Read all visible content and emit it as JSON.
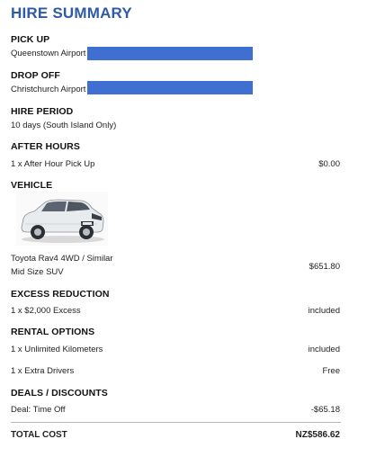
{
  "title": "HIRE SUMMARY",
  "pickup": {
    "heading": "PICK UP",
    "location": "Queenstown Airport"
  },
  "dropoff": {
    "heading": "DROP OFF",
    "location": "Christchurch Airport"
  },
  "hire_period": {
    "heading": "HIRE PERIOD",
    "value": "10 days (South Island Only)"
  },
  "after_hours": {
    "heading": "AFTER HOURS",
    "item": "1 x After Hour Pick Up",
    "price": "$0.00"
  },
  "vehicle": {
    "heading": "VEHICLE",
    "image_icon": "suv-car-icon",
    "name": "Toyota Rav4 4WD / Similar",
    "category": "Mid Size SUV",
    "price": "$651.80"
  },
  "excess_reduction": {
    "heading": "EXCESS REDUCTION",
    "item": "1 x $2,000 Excess",
    "price": "included"
  },
  "rental_options": {
    "heading": "RENTAL OPTIONS",
    "items": [
      {
        "label": "1 x Unlimited Kilometers",
        "price": "included"
      },
      {
        "label": "1 x Extra Drivers",
        "price": "Free"
      }
    ]
  },
  "deals": {
    "heading": "DEALS / DISCOUNTS",
    "item": "Deal: Time Off",
    "price": "-$65.18"
  },
  "total": {
    "label": "TOTAL COST",
    "value": "NZ$586.62"
  },
  "colors": {
    "title": "#2f5aa5",
    "redaction": "#3e6fd1"
  }
}
